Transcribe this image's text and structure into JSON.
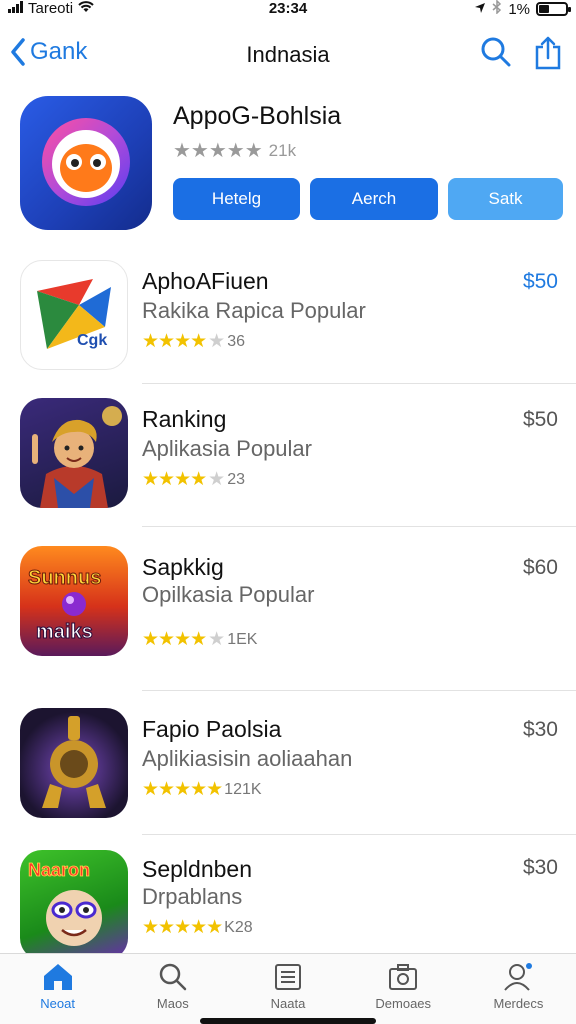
{
  "status_bar": {
    "carrier": "Tareoti",
    "time": "23:34",
    "battery": "1%"
  },
  "nav": {
    "back_label": "Gank",
    "title": "Indnasia"
  },
  "hero": {
    "name": "AppoG-Bohlsia",
    "rating_count": "21k",
    "buttons": [
      "Hetelg",
      "Aerch",
      "Satk"
    ]
  },
  "apps": [
    {
      "name": "AphoAFiuen",
      "subtitle": "Rakika Rapica Popular",
      "rating_count": "36",
      "stars": 3.5,
      "price": "$50",
      "price_color": "#1f7ae0",
      "icon_text": "Cgk"
    },
    {
      "name": "Ranking",
      "subtitle": "Aplikasia Popular",
      "rating_count": "23",
      "stars": 3.5,
      "price": "$50"
    },
    {
      "name": "Sapkkig",
      "subtitle": "Opilkasia Popular",
      "rating_count": "1EK",
      "stars": 3.5,
      "price": "$60",
      "icon_text_top": "Sunnus",
      "icon_text_bottom": "maiks"
    },
    {
      "name": "Fapio Paolsia",
      "subtitle": "Aplikiasisin aoliaahan",
      "rating_count": "121K",
      "stars": 4.5,
      "price": "$30"
    },
    {
      "name": "Sepldnben",
      "subtitle": "Drpablans",
      "rating_count": "K28",
      "stars": 4.5,
      "price": "$30",
      "icon_text": "Naaron"
    }
  ],
  "tabs": [
    {
      "label": "Neoat",
      "icon": "home-icon",
      "active": true
    },
    {
      "label": "Maos",
      "icon": "search-icon",
      "active": false
    },
    {
      "label": "Naata",
      "icon": "list-icon",
      "active": false
    },
    {
      "label": "Demoaes",
      "icon": "camera-icon",
      "active": false
    },
    {
      "label": "Merdecs",
      "icon": "user-icon",
      "active": false
    }
  ],
  "colors": {
    "accent": "#1f7ae0",
    "star": "#f2c200",
    "button": "#1b6fe4",
    "button_light": "#4fa8f3"
  }
}
